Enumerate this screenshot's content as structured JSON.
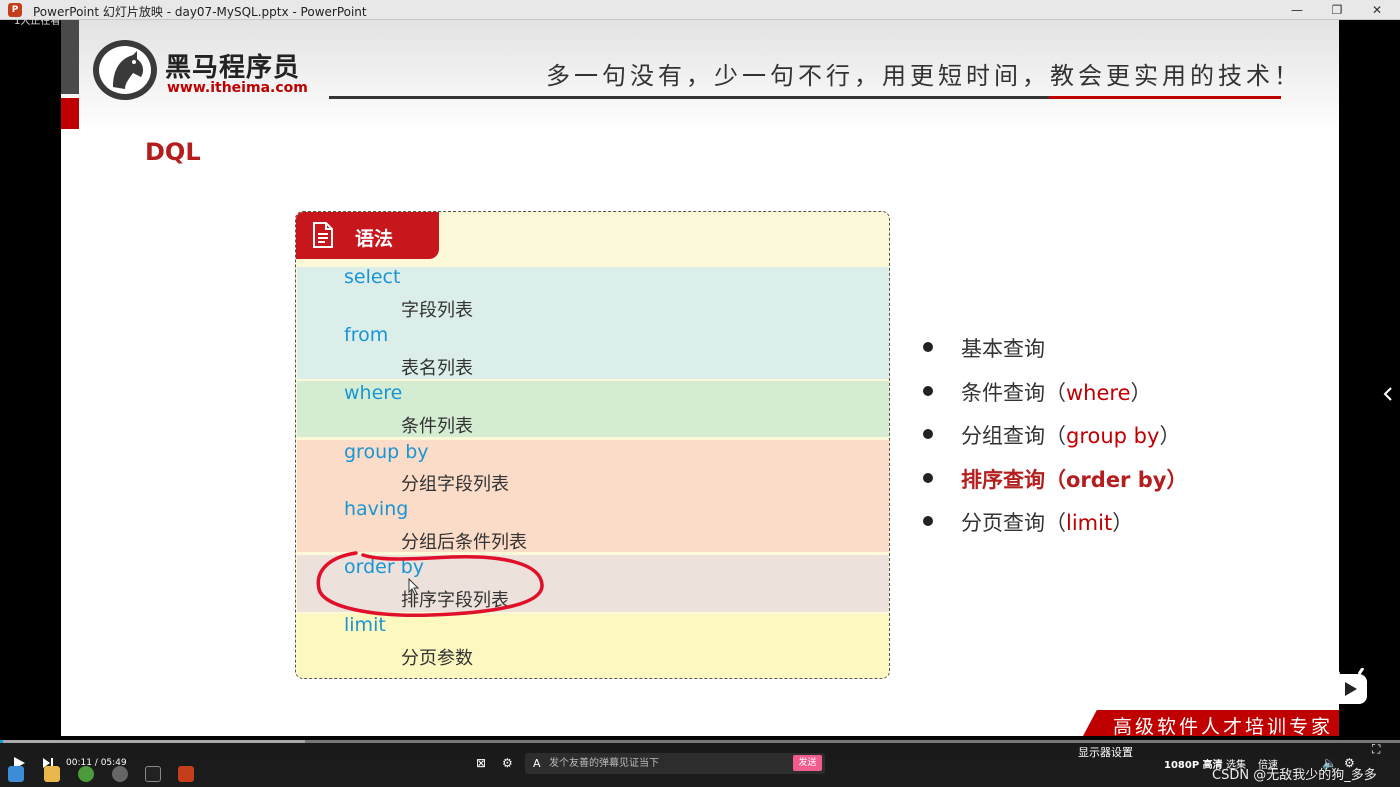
{
  "window": {
    "title": "PowerPoint 幻灯片放映  -  day07-MySQL.pptx - PowerPoint",
    "app_icon": "P",
    "minimize": "—",
    "restore": "❐",
    "close": "✕",
    "left_overlay_text": "1大正在看"
  },
  "header": {
    "logo_cn": "黑马程序员",
    "logo_url": "www.itheima.com",
    "slogan": "多一句没有，少一句不行，用更短时间，教会更实用的技术！"
  },
  "slide_title": "DQL",
  "syntax": {
    "tab_label": "语法",
    "rows": [
      {
        "keyword": "select",
        "desc": "字段列表"
      },
      {
        "keyword": "from",
        "desc": "表名列表"
      },
      {
        "keyword": "where",
        "desc": "条件列表"
      },
      {
        "keyword": "group  by",
        "desc": "分组字段列表"
      },
      {
        "keyword": "having",
        "desc": "分组后条件列表"
      },
      {
        "keyword": "order by",
        "desc": "排序字段列表"
      },
      {
        "keyword": "limit",
        "desc": "分页参数"
      }
    ]
  },
  "bullets": [
    {
      "text": "基本查询",
      "kw": "",
      "close": ""
    },
    {
      "text": "条件查询（",
      "kw": "where",
      "close": "）"
    },
    {
      "text": "分组查询（",
      "kw": "group by",
      "close": "）"
    },
    {
      "text": "排序查询（order by）",
      "kw": "",
      "close": ""
    },
    {
      "text": "分页查询（",
      "kw": "limit",
      "close": "）"
    }
  ],
  "active_bullet_index": 3,
  "footer_badge": "高级软件人才培训专家",
  "player": {
    "time": "00:11 / 05:49",
    "danmaku_placeholder": "发个友善的弹幕见证当下",
    "send_label": "发送",
    "display_settings": "显示器设置",
    "quality": "1080P 高清",
    "select_episode": "选集",
    "speed": "倍速",
    "watermark": "CSDN @无敌我少的狗_多多",
    "progress_fraction": 0.032
  },
  "colors": {
    "accent_red": "#c00000",
    "keyword_blue": "#1a95d4",
    "annotation_red": "#e0102a"
  }
}
